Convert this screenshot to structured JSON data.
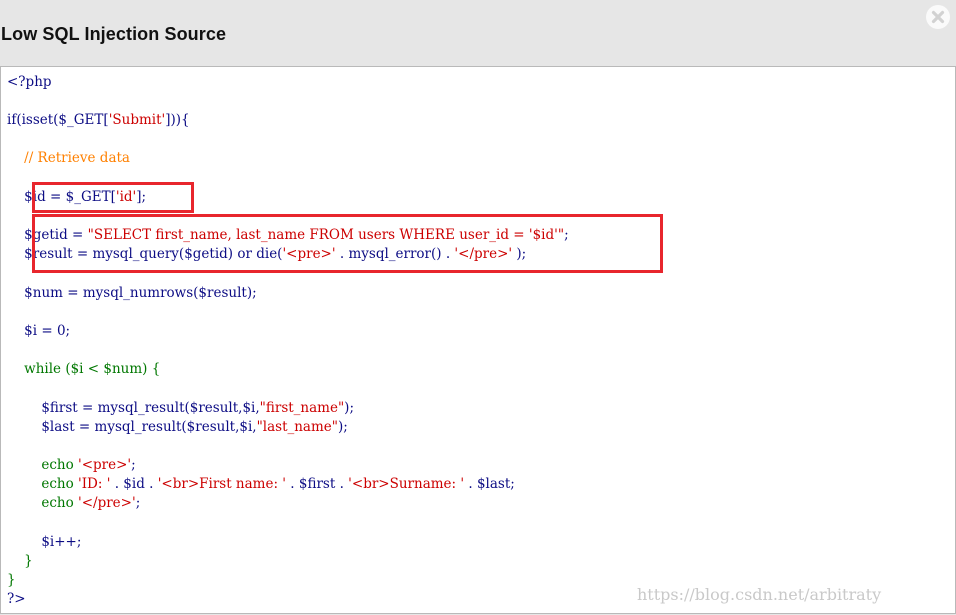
{
  "window": {
    "title": "Low SQL Injection Source",
    "close_icon": "close-icon"
  },
  "code": {
    "language": "php",
    "lines": [
      {
        "id": "l01",
        "parts": [
          {
            "t": "<?php",
            "c": "default"
          }
        ]
      },
      {
        "id": "l02",
        "parts": [
          {
            "t": "if(isset($_GET[",
            "c": "default"
          },
          {
            "t": "'Submit'",
            "c": "string"
          },
          {
            "t": "])){",
            "c": "default"
          }
        ]
      },
      {
        "id": "l03",
        "parts": [
          {
            "t": "    // Retrieve data",
            "c": "comment"
          }
        ]
      },
      {
        "id": "l04",
        "parts": [
          {
            "t": "    $id = $_GET[",
            "c": "default"
          },
          {
            "t": "'id'",
            "c": "string"
          },
          {
            "t": "];",
            "c": "default"
          }
        ]
      },
      {
        "id": "l05",
        "parts": [
          {
            "t": "    $getid = ",
            "c": "default"
          },
          {
            "t": "\"SELECT first_name, last_name FROM users WHERE user_id = '$id'\"",
            "c": "string"
          },
          {
            "t": ";",
            "c": "default"
          }
        ]
      },
      {
        "id": "l06",
        "parts": [
          {
            "t": "    $result = mysql_query($getid) or die(",
            "c": "default"
          },
          {
            "t": "'<pre>'",
            "c": "string"
          },
          {
            "t": " . mysql_error() . ",
            "c": "default"
          },
          {
            "t": "'</pre>'",
            "c": "string"
          },
          {
            "t": " );",
            "c": "default"
          }
        ]
      },
      {
        "id": "l07",
        "parts": [
          {
            "t": "    $num = mysql_numrows($result);",
            "c": "default"
          }
        ]
      },
      {
        "id": "l08",
        "parts": [
          {
            "t": "    $i = 0;",
            "c": "default"
          }
        ]
      },
      {
        "id": "l09",
        "parts": [
          {
            "t": "    while ($i < $num) {",
            "c": "keyword"
          }
        ]
      },
      {
        "id": "l10",
        "parts": [
          {
            "t": "        $first = mysql_result($result,$i,",
            "c": "default"
          },
          {
            "t": "\"first_name\"",
            "c": "string"
          },
          {
            "t": ");",
            "c": "default"
          }
        ]
      },
      {
        "id": "l11",
        "parts": [
          {
            "t": "        $last = mysql_result($result,$i,",
            "c": "default"
          },
          {
            "t": "\"last_name\"",
            "c": "string"
          },
          {
            "t": ");",
            "c": "default"
          }
        ]
      },
      {
        "id": "l12",
        "parts": [
          {
            "t": "        echo ",
            "c": "keyword"
          },
          {
            "t": "'<pre>'",
            "c": "string"
          },
          {
            "t": ";",
            "c": "default"
          }
        ]
      },
      {
        "id": "l13",
        "parts": [
          {
            "t": "        echo ",
            "c": "keyword"
          },
          {
            "t": "'ID: '",
            "c": "string"
          },
          {
            "t": " . $id . ",
            "c": "default"
          },
          {
            "t": "'<br>First name: '",
            "c": "string"
          },
          {
            "t": " . $first . ",
            "c": "default"
          },
          {
            "t": "'<br>Surname: '",
            "c": "string"
          },
          {
            "t": " . $last;",
            "c": "default"
          }
        ]
      },
      {
        "id": "l14",
        "parts": [
          {
            "t": "        echo ",
            "c": "keyword"
          },
          {
            "t": "'</pre>'",
            "c": "string"
          },
          {
            "t": ";",
            "c": "default"
          }
        ]
      },
      {
        "id": "l15",
        "parts": [
          {
            "t": "        $i++;",
            "c": "default"
          }
        ]
      },
      {
        "id": "l16",
        "parts": [
          {
            "t": "    }",
            "c": "keyword"
          }
        ]
      },
      {
        "id": "l17",
        "parts": [
          {
            "t": "}",
            "c": "keyword"
          }
        ]
      },
      {
        "id": "l18",
        "parts": [
          {
            "t": "?>",
            "c": "default"
          }
        ]
      }
    ]
  },
  "highlights": [
    "id-assignment",
    "query-execution"
  ],
  "watermark": "https://blog.csdn.net/arbitraty",
  "colors": {
    "default": "#0c0c84",
    "string": "#cc0000",
    "comment": "#ff8000",
    "keyword": "#007700",
    "highlight_border": "#e8262d",
    "title_bar": "#e6e6e6"
  }
}
